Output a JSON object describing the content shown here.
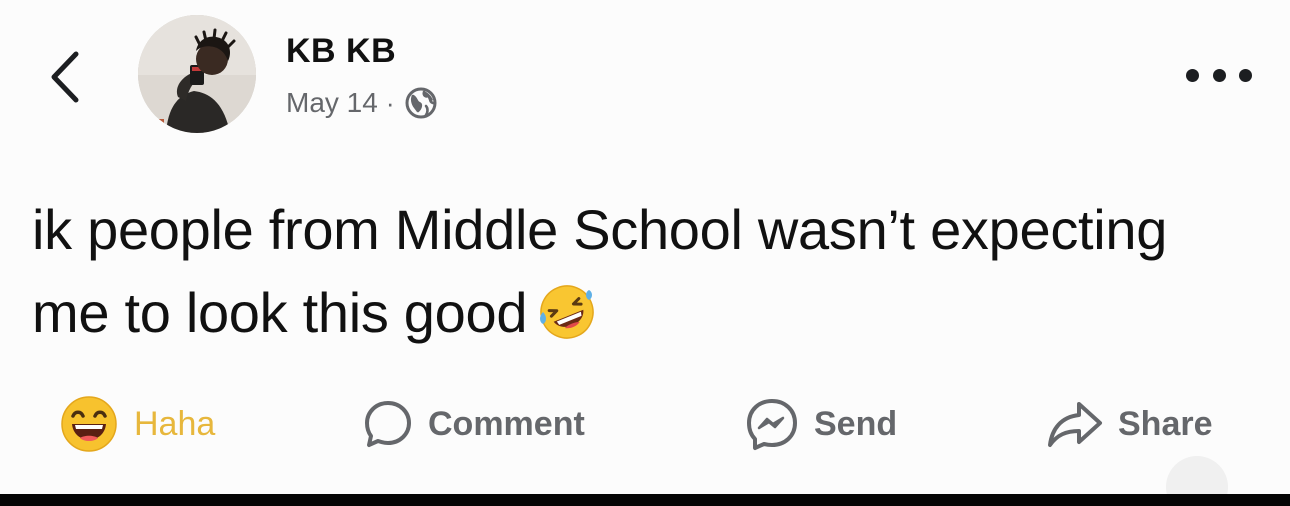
{
  "header": {
    "back_icon": "chevron-left-icon",
    "author_name": "KB KB",
    "date": "May 14",
    "separator": "·",
    "privacy_icon": "globe-icon",
    "more_icon": "ellipsis-icon"
  },
  "post": {
    "text": "ik people from Middle School wasn’t expecting me to look this good",
    "emoji_icon": "rolling-on-floor-laughing-emoji"
  },
  "actions": {
    "reaction_label": "Haha",
    "comment_label": "Comment",
    "send_label": "Send",
    "share_label": "Share"
  },
  "colors": {
    "reaction_active": "#e7b73c",
    "action_text": "#65676b",
    "meta_text": "#65676b"
  }
}
